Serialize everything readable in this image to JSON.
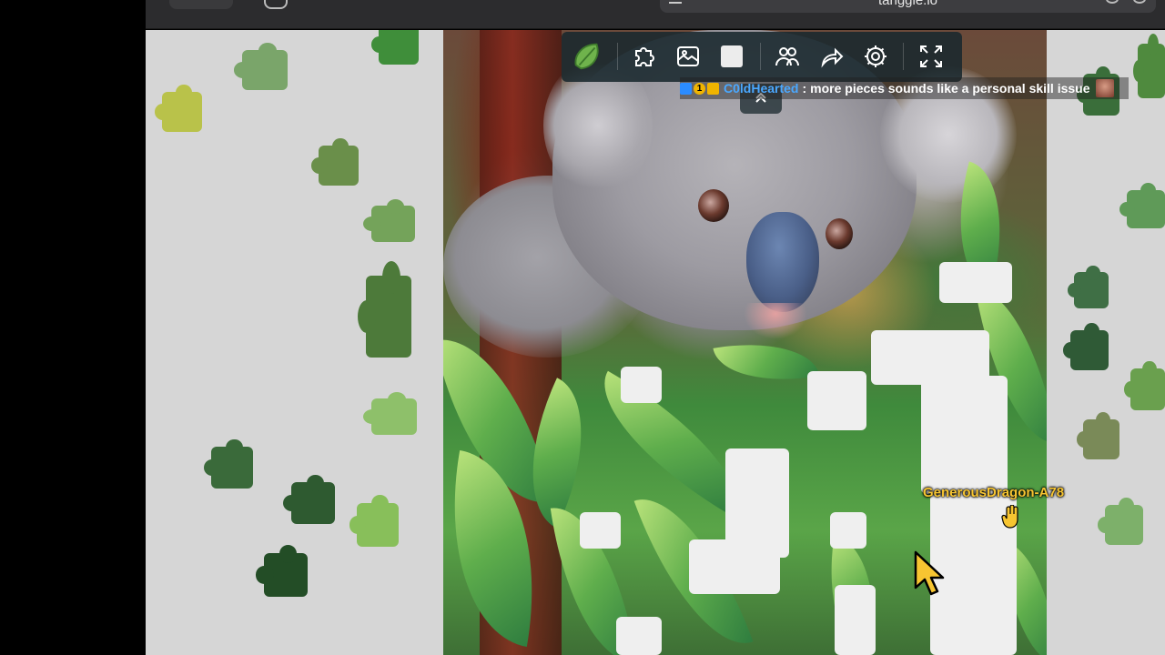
{
  "browser": {
    "address": "tanggle.io"
  },
  "toolbar": {
    "buttons": [
      {
        "name": "puzzle-piece-icon"
      },
      {
        "name": "preview-image-icon"
      },
      {
        "name": "background-color-icon"
      },
      {
        "name": "players-icon"
      },
      {
        "name": "share-icon"
      },
      {
        "name": "settings-gear-icon"
      },
      {
        "name": "fullscreen-icon"
      }
    ]
  },
  "chat": {
    "username": "C0ldHearted",
    "separator": ":",
    "message": "more pieces sounds like a personal skill issue",
    "badge_number": "1"
  },
  "player_cursor": {
    "name": "GenerousDragon-A78",
    "color": "#f7c531"
  },
  "colors": {
    "workspace": "#d6d6d6",
    "toolbar": "#19282d",
    "chat_user": "#4aa8ff"
  }
}
